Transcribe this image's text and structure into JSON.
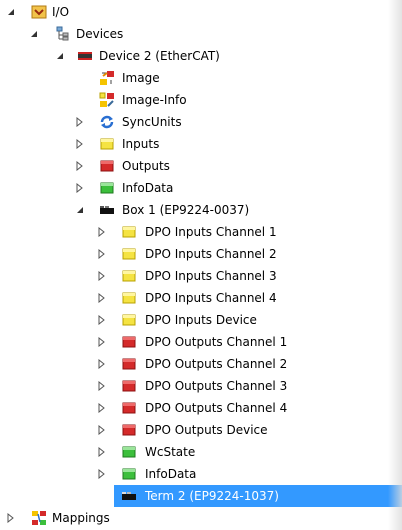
{
  "tree": [
    {
      "label": "I/O",
      "level": 0,
      "expander": "expanded",
      "icon": "io-folder-icon"
    },
    {
      "label": "Devices",
      "level": 1,
      "expander": "expanded",
      "icon": "devices-icon"
    },
    {
      "label": "Device 2 (EtherCAT)",
      "level": 2,
      "expander": "expanded",
      "icon": "ethercat-device-icon"
    },
    {
      "label": "Image",
      "level": 3,
      "expander": "none",
      "icon": "image-icon"
    },
    {
      "label": "Image-Info",
      "level": 3,
      "expander": "none",
      "icon": "image-info-icon"
    },
    {
      "label": "SyncUnits",
      "level": 3,
      "expander": "collapsed",
      "icon": "syncunits-icon"
    },
    {
      "label": "Inputs",
      "level": 3,
      "expander": "collapsed",
      "icon": "inputs-icon"
    },
    {
      "label": "Outputs",
      "level": 3,
      "expander": "collapsed",
      "icon": "outputs-icon"
    },
    {
      "label": "InfoData",
      "level": 3,
      "expander": "collapsed",
      "icon": "infodata-icon"
    },
    {
      "label": "Box 1 (EP9224-0037)",
      "level": 3,
      "expander": "expanded",
      "icon": "box-module-icon"
    },
    {
      "label": "DPO Inputs Channel 1",
      "level": 4,
      "expander": "collapsed",
      "icon": "inputs-icon"
    },
    {
      "label": "DPO Inputs Channel 2",
      "level": 4,
      "expander": "collapsed",
      "icon": "inputs-icon"
    },
    {
      "label": "DPO Inputs Channel 3",
      "level": 4,
      "expander": "collapsed",
      "icon": "inputs-icon"
    },
    {
      "label": "DPO Inputs Channel 4",
      "level": 4,
      "expander": "collapsed",
      "icon": "inputs-icon"
    },
    {
      "label": "DPO Inputs Device",
      "level": 4,
      "expander": "collapsed",
      "icon": "inputs-icon"
    },
    {
      "label": "DPO Outputs Channel 1",
      "level": 4,
      "expander": "collapsed",
      "icon": "outputs-icon"
    },
    {
      "label": "DPO Outputs Channel 2",
      "level": 4,
      "expander": "collapsed",
      "icon": "outputs-icon"
    },
    {
      "label": "DPO Outputs Channel 3",
      "level": 4,
      "expander": "collapsed",
      "icon": "outputs-icon"
    },
    {
      "label": "DPO Outputs Channel 4",
      "level": 4,
      "expander": "collapsed",
      "icon": "outputs-icon"
    },
    {
      "label": "DPO Outputs Device",
      "level": 4,
      "expander": "collapsed",
      "icon": "outputs-icon"
    },
    {
      "label": "WcState",
      "level": 4,
      "expander": "collapsed",
      "icon": "infodata-icon"
    },
    {
      "label": "InfoData",
      "level": 4,
      "expander": "collapsed",
      "icon": "infodata-icon"
    },
    {
      "label": "Term 2 (EP9224-1037)",
      "level": 4,
      "expander": "collapsed",
      "icon": "terminal-module-icon",
      "selected": true
    },
    {
      "label": "Mappings",
      "level": 0,
      "expander": "collapsed",
      "icon": "mappings-icon"
    }
  ],
  "colors": {
    "selection": "#3399ff",
    "inputs": "#f5e342",
    "outputs": "#d42a2a",
    "infodata": "#3cbf3c"
  }
}
